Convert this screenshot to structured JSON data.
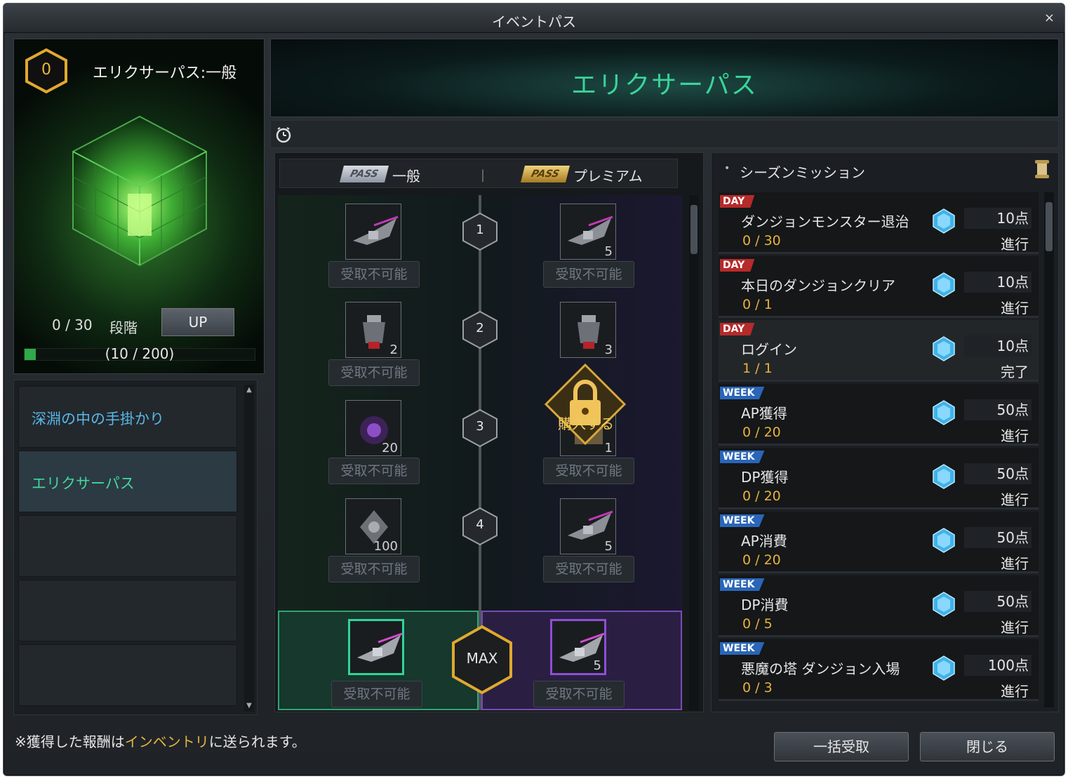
{
  "window": {
    "title": "イベントパス",
    "close_label": "×"
  },
  "summary": {
    "level": "0",
    "pass_name": "エリクサーパス:一般",
    "progress": "0 / 30",
    "stage_label": "段階",
    "up_label": "UP",
    "xp_text": "(10 / 200)",
    "xp_fraction": 0.05
  },
  "nav": {
    "items": [
      {
        "label": "深淵の中の手掛かり"
      },
      {
        "label": "エリクサーパス"
      }
    ]
  },
  "banner": {
    "title": "エリクサーパス"
  },
  "track": {
    "normal_badge": "PASS",
    "normal_label": "一般",
    "premium_badge": "PASS",
    "premium_label": "プレミアム",
    "separator": "|",
    "claim_label": "受取不可能",
    "buy_label": "購入する",
    "max_label": "MAX",
    "rows": [
      {
        "level": "1",
        "normal_qty": "",
        "premium_qty": "5"
      },
      {
        "level": "2",
        "normal_qty": "2",
        "premium_qty": "3"
      },
      {
        "level": "3",
        "normal_qty": "20",
        "premium_qty": "1"
      },
      {
        "level": "4",
        "normal_qty": "100",
        "premium_qty": "5"
      }
    ],
    "max_row": {
      "normal_qty": "",
      "premium_qty": "5"
    }
  },
  "missions": {
    "title": "シーズンミッション",
    "items": [
      {
        "tag": "DAY",
        "name": "ダンジョンモンスター退治",
        "progress": "0 / 30",
        "points": "10点",
        "status": "進行"
      },
      {
        "tag": "DAY",
        "name": "本日のダンジョンクリア",
        "progress": "0 / 1",
        "points": "10点",
        "status": "進行"
      },
      {
        "tag": "DAY",
        "name": "ログイン",
        "progress": "1 / 1",
        "points": "10点",
        "status": "完了"
      },
      {
        "tag": "WEEK",
        "name": "AP獲得",
        "progress": "0 / 20",
        "points": "50点",
        "status": "進行"
      },
      {
        "tag": "WEEK",
        "name": "DP獲得",
        "progress": "0 / 20",
        "points": "50点",
        "status": "進行"
      },
      {
        "tag": "WEEK",
        "name": "AP消費",
        "progress": "0 / 20",
        "points": "50点",
        "status": "進行"
      },
      {
        "tag": "WEEK",
        "name": "DP消費",
        "progress": "0 / 5",
        "points": "50点",
        "status": "進行"
      },
      {
        "tag": "WEEK",
        "name": "悪魔の塔 ダンジョン入場",
        "progress": "0 / 3",
        "points": "100点",
        "status": "進行"
      }
    ]
  },
  "footer": {
    "note_prefix": "※獲得した報酬は",
    "note_highlight": "インベントリ",
    "note_suffix": "に送られます。",
    "claim_all_label": "一括受取",
    "close_label": "閉じる"
  },
  "colors": {
    "accent_green": "#39d49a",
    "gold": "#e7b73b",
    "day_tag": "#b62a2a",
    "week_tag": "#2a66b8"
  }
}
